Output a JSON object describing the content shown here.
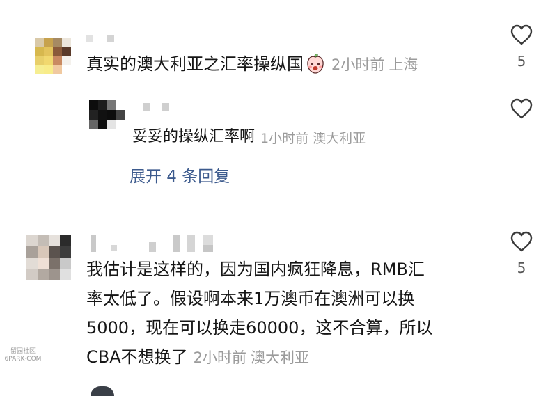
{
  "comments": [
    {
      "text": "真实的澳大利亚之汇率操纵国",
      "emoji": "peach-face-icon",
      "time": "2小时前",
      "location": "上海",
      "likes": "5",
      "reply": {
        "text": "妥妥的操纵汇率啊",
        "time": "1小时前",
        "location": "澳大利亚"
      },
      "expand_label": "展开 4 条回复"
    },
    {
      "lines": [
        "我估计是这样的，因为国内疯狂降息，RMB汇",
        "率太低了。假设啊本来1万澳币在澳洲可以换",
        "5000，现在可以换走60000，这不合算，所以",
        "CBA不想换了"
      ],
      "time": "2小时前",
      "location": "澳大利亚",
      "likes": "5"
    }
  ],
  "watermark": {
    "line1": "留园社区",
    "line2": "6PARK·COM"
  },
  "colors": {
    "text": "#161616",
    "meta": "#9b9b9b",
    "link": "#3c5a8d",
    "divider": "#e9e9e9"
  }
}
